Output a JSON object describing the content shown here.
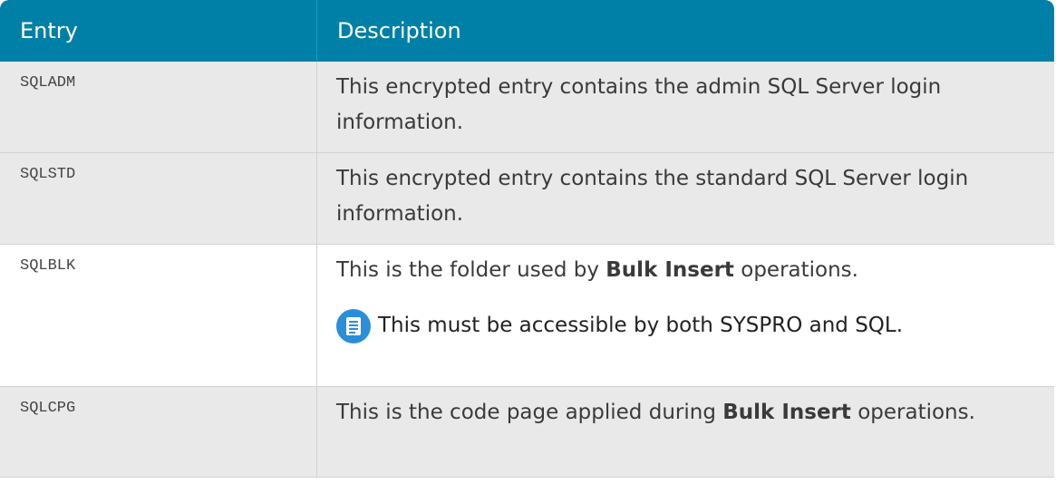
{
  "table": {
    "headers": {
      "entry": "Entry",
      "description": "Description"
    },
    "rows": [
      {
        "entry": "SQLADM",
        "description": "This encrypted entry contains the admin SQL Server login information."
      },
      {
        "entry": "SQLSTD",
        "description": "This encrypted entry contains the standard SQL Server login information."
      },
      {
        "entry": "SQLBLK",
        "description_before": "This is the folder used by ",
        "description_bold": "Bulk Insert",
        "description_after": " operations.",
        "note": {
          "icon": "note-document-icon",
          "text": "This must be accessible by both SYSPRO and SQL."
        }
      },
      {
        "entry": "SQLCPG",
        "description_before": "This is the code page applied during ",
        "description_bold": "Bulk Insert",
        "description_after": " operations."
      }
    ]
  },
  "colors": {
    "header_background": "#0080a6",
    "header_text": "#ffffff",
    "shaded_row": "#e9e9e9",
    "note_icon": "#2a8fd8"
  }
}
